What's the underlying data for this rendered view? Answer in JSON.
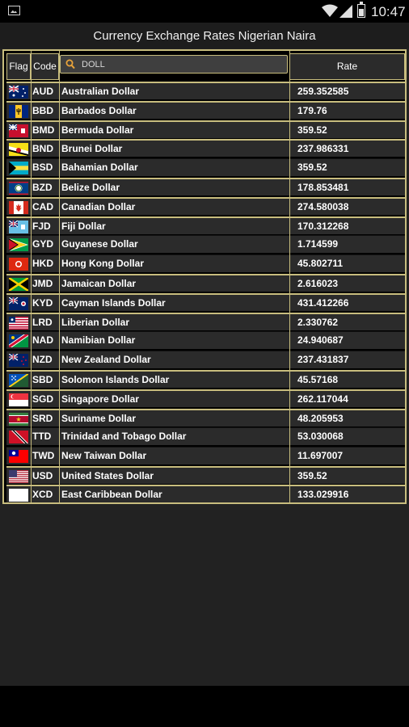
{
  "status_bar": {
    "time": "10:47",
    "icons": [
      "picture-icon",
      "wifi-icon",
      "signal-icon",
      "battery-icon"
    ]
  },
  "app": {
    "title": "Currency Exchange Rates Nigerian Naira"
  },
  "table": {
    "headers": {
      "flag": "Flag",
      "code": "Code",
      "rate": "Rate"
    },
    "search": {
      "value": "DOLL",
      "placeholder": ""
    },
    "rows": [
      {
        "code": "AUD",
        "name": "Australian Dollar",
        "rate": "259.352585",
        "flag": "australia"
      },
      {
        "code": "BBD",
        "name": "Barbados Dollar",
        "rate": "179.76",
        "flag": "barbados"
      },
      {
        "code": "BMD",
        "name": "Bermuda Dollar",
        "rate": "359.52",
        "flag": "bermuda"
      },
      {
        "code": "BND",
        "name": "Brunei Dollar",
        "rate": "237.986331",
        "flag": "brunei"
      },
      {
        "code": "BSD",
        "name": "Bahamian Dollar",
        "rate": "359.52",
        "flag": "bahamas"
      },
      {
        "code": "BZD",
        "name": "Belize Dollar",
        "rate": "178.853481",
        "flag": "belize"
      },
      {
        "code": "CAD",
        "name": "Canadian Dollar",
        "rate": "274.580038",
        "flag": "canada"
      },
      {
        "code": "FJD",
        "name": "Fiji Dollar",
        "rate": "170.312268",
        "flag": "fiji"
      },
      {
        "code": "GYD",
        "name": "Guyanese Dollar",
        "rate": "1.714599",
        "flag": "guyana"
      },
      {
        "code": "HKD",
        "name": "Hong Kong Dollar",
        "rate": "45.802711",
        "flag": "hongkong"
      },
      {
        "code": "JMD",
        "name": "Jamaican Dollar",
        "rate": "2.616023",
        "flag": "jamaica"
      },
      {
        "code": "KYD",
        "name": "Cayman Islands Dollar",
        "rate": "431.412266",
        "flag": "cayman"
      },
      {
        "code": "LRD",
        "name": "Liberian Dollar",
        "rate": "2.330762",
        "flag": "liberia"
      },
      {
        "code": "NAD",
        "name": "Namibian Dollar",
        "rate": "24.940687",
        "flag": "namibia"
      },
      {
        "code": "NZD",
        "name": "New Zealand Dollar",
        "rate": "237.431837",
        "flag": "newzealand"
      },
      {
        "code": "SBD",
        "name": "Solomon Islands Dollar",
        "rate": "45.57168",
        "flag": "solomon"
      },
      {
        "code": "SGD",
        "name": "Singapore Dollar",
        "rate": "262.117044",
        "flag": "singapore"
      },
      {
        "code": "SRD",
        "name": "Suriname Dollar",
        "rate": "48.205953",
        "flag": "suriname"
      },
      {
        "code": "TTD",
        "name": "Trinidad and Tobago Dollar",
        "rate": "53.030068",
        "flag": "trinidad"
      },
      {
        "code": "TWD",
        "name": "New Taiwan Dollar",
        "rate": "11.697007",
        "flag": "taiwan"
      },
      {
        "code": "USD",
        "name": "United States Dollar",
        "rate": "359.52",
        "flag": "usa"
      },
      {
        "code": "XCD",
        "name": "East Caribbean Dollar",
        "rate": "133.029916",
        "flag": "blank"
      }
    ]
  },
  "colors": {
    "border": "#c8bd7e",
    "cell": "#2b2b2b",
    "background": "#222222"
  }
}
